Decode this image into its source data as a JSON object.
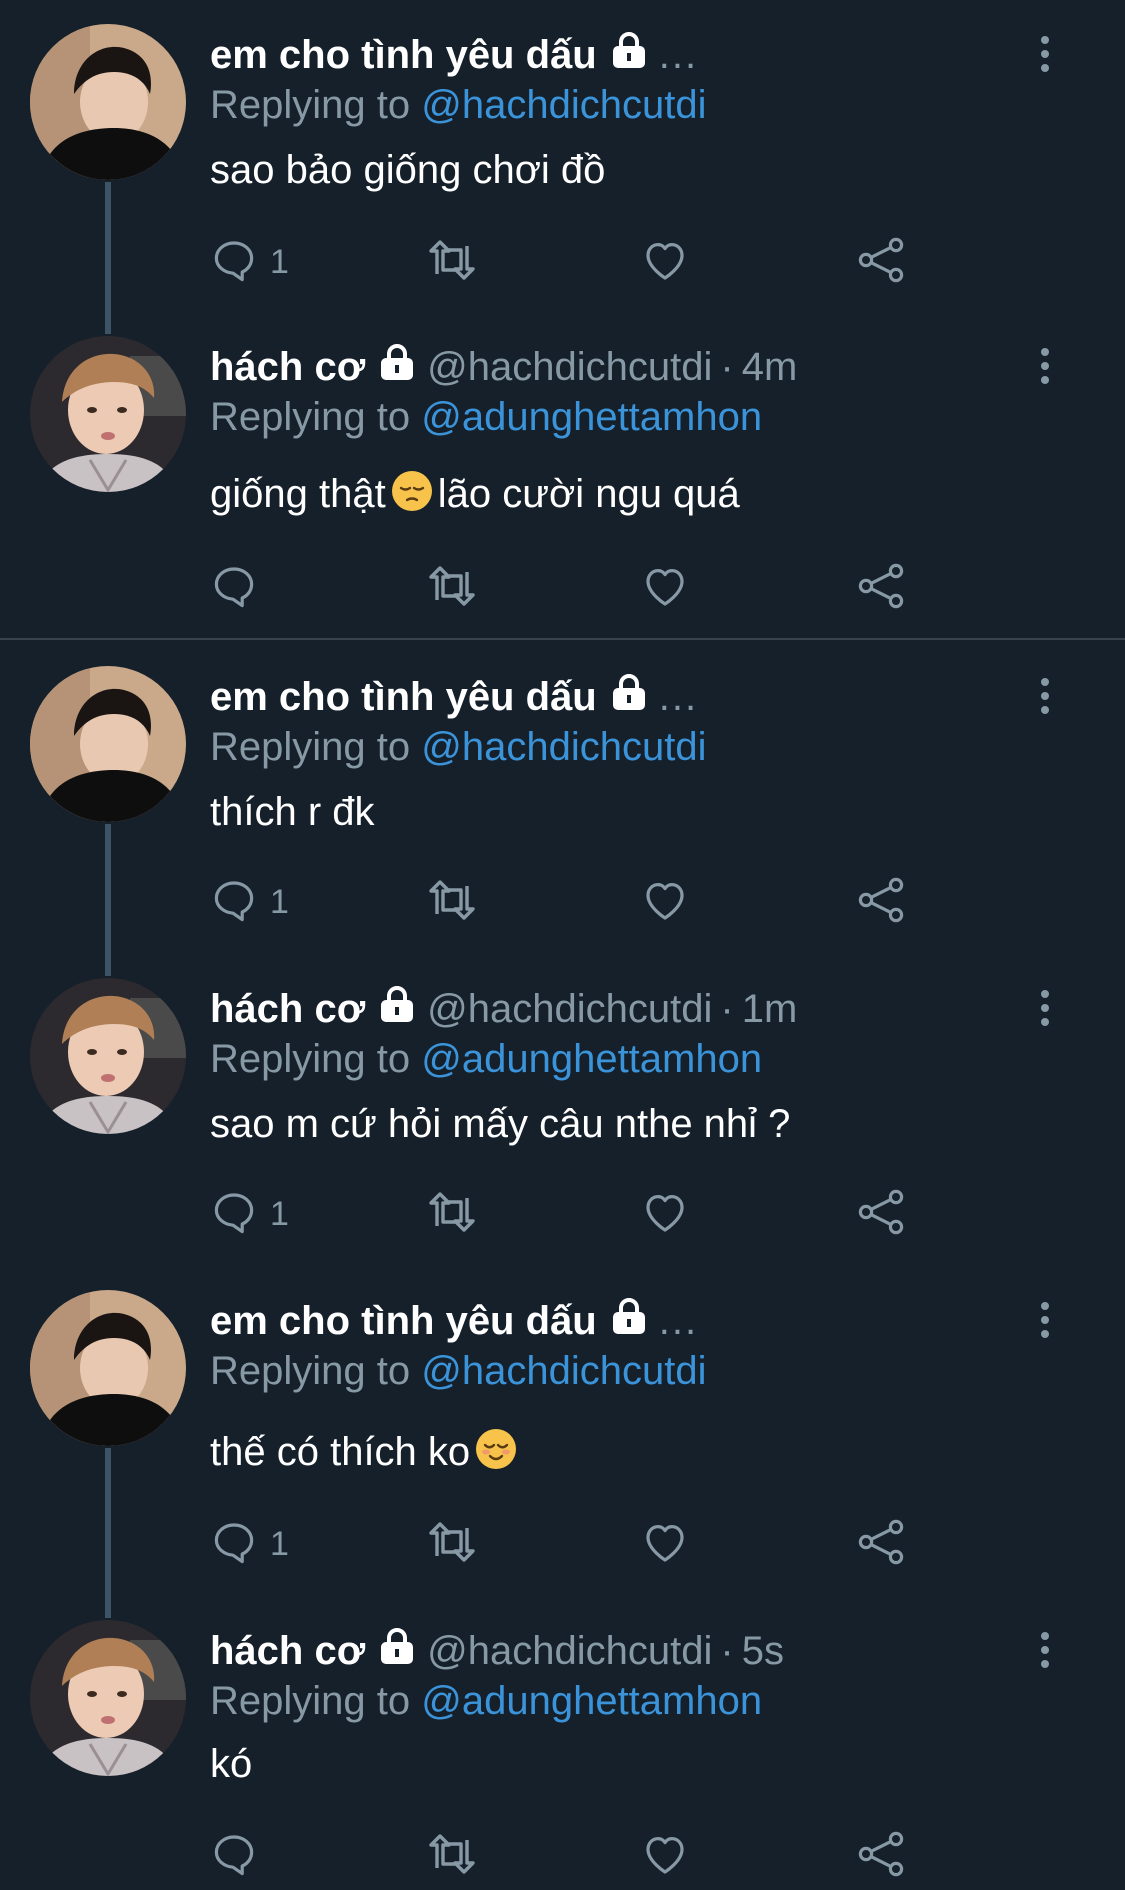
{
  "colors": {
    "background": "#15202b",
    "primary_text": "#ffffff",
    "secondary_text": "#8899a6",
    "mention": "#3b94d9",
    "thread_line": "#3d5466",
    "divider": "#38444d"
  },
  "tweets": [
    {
      "name": "em cho tình yêu dấu",
      "handle": "",
      "time": "",
      "more": "...",
      "replying_prefix": "Replying to",
      "replying_to": "@hachdichcutdi",
      "text": "sao bảo giống chơi đồ",
      "emoji": "",
      "text_after": "",
      "reply_count": "1",
      "avatar": "avatar-em",
      "icons": [
        "lock-icon",
        "more-options-icon",
        "reply-icon",
        "retweet-icon",
        "like-icon",
        "share-icon"
      ]
    },
    {
      "name": "hách cơ",
      "handle": "@hachdichcutdi",
      "time": "4m",
      "more": "",
      "replying_prefix": "Replying to",
      "replying_to": "@adunghettamhon",
      "text": "giống thật",
      "emoji": "pensive-emoji",
      "text_after": "lão cười ngu quá",
      "reply_count": "",
      "avatar": "avatar-hach"
    },
    {
      "name": "em cho tình yêu dấu",
      "handle": "",
      "time": "",
      "more": "...",
      "replying_prefix": "Replying to",
      "replying_to": "@hachdichcutdi",
      "text": "thích r đk",
      "emoji": "",
      "text_after": "",
      "reply_count": "1",
      "avatar": "avatar-em"
    },
    {
      "name": "hách cơ",
      "handle": "@hachdichcutdi",
      "time": "1m",
      "more": "",
      "replying_prefix": "Replying to",
      "replying_to": "@adunghettamhon",
      "text": "sao m cứ hỏi mấy câu nthe nhỉ ?",
      "emoji": "",
      "text_after": "",
      "reply_count": "1",
      "avatar": "avatar-hach"
    },
    {
      "name": "em cho tình yêu dấu",
      "handle": "",
      "time": "",
      "more": "...",
      "replying_prefix": "Replying to",
      "replying_to": "@hachdichcutdi",
      "text": "thế có thích ko",
      "emoji": "relieved-emoji",
      "text_after": "",
      "reply_count": "1",
      "avatar": "avatar-em"
    },
    {
      "name": "hách cơ",
      "handle": "@hachdichcutdi",
      "time": "5s",
      "more": "",
      "replying_prefix": "Replying to",
      "replying_to": "@adunghettamhon",
      "text": "kó",
      "emoji": "",
      "text_after": "",
      "reply_count": "",
      "avatar": "avatar-hach"
    }
  ]
}
